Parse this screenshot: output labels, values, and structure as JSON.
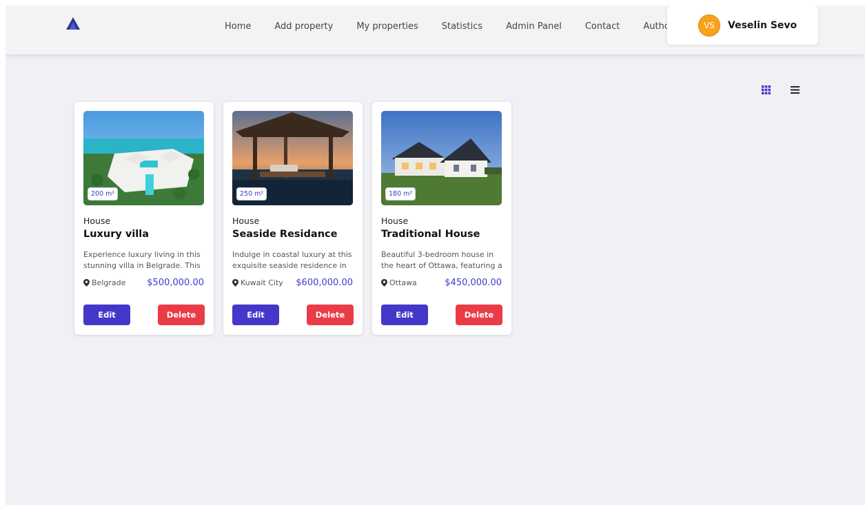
{
  "nav": {
    "links": [
      "Home",
      "Add property",
      "My properties",
      "Statistics",
      "Admin Panel",
      "Contact",
      "Author"
    ],
    "user": {
      "initials": "VS",
      "name": "Veselin Sevo"
    }
  },
  "colors": {
    "accent": "#4338c9",
    "danger": "#ea3c46",
    "avatar": "#f7a21a",
    "price": "#3b3bd0"
  },
  "view_toggle": {
    "grid_icon": "grid-icon",
    "list_icon": "list-icon",
    "active": "grid"
  },
  "cards": [
    {
      "area": "200 m²",
      "type": "House",
      "title": "Luxury villa",
      "description": "Experience luxury living in this stunning villa in Belgrade. This",
      "location": "Belgrade",
      "price": "$500,000.00",
      "edit_label": "Edit",
      "delete_label": "Delete"
    },
    {
      "area": "250 m²",
      "type": "House",
      "title": "Seaside Residance",
      "description": "Indulge in coastal luxury at this exquisite seaside residence in",
      "location": "Kuwait City",
      "price": "$600,000.00",
      "edit_label": "Edit",
      "delete_label": "Delete"
    },
    {
      "area": "180 m²",
      "type": "House",
      "title": "Traditional House",
      "description": "Beautiful 3-bedroom house in the heart of Ottawa, featuring a",
      "location": "Ottawa",
      "price": "$450,000.00",
      "edit_label": "Edit",
      "delete_label": "Delete"
    }
  ]
}
